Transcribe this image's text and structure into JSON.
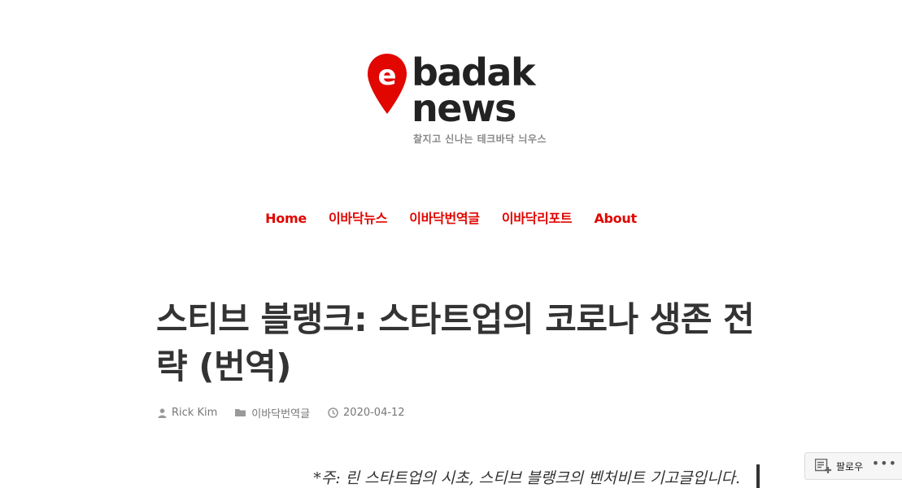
{
  "site": {
    "logo_line1": "badak",
    "logo_line2": "news",
    "logo_pin_letter": "e",
    "tagline": "찰지고 신나는 테크바닥 늬우스",
    "brand_color": "#e10600"
  },
  "nav": {
    "items": [
      "Home",
      "이바닥뉴스",
      "이바닥번역글",
      "이바닥리포트",
      "About"
    ]
  },
  "post": {
    "title": "스티브 블랭크: 스타트업의 코로나 생존 전략 (번역)",
    "author": "Rick Kim",
    "category": "이바닥번역글",
    "date": "2020-04-12",
    "intro": "*주: 린 스타트업의 시초, 스티브 블랭크의 벤처비트 기고글입니다."
  },
  "follow_widget": {
    "label": "팔로우",
    "more": "•••",
    "icon": "reader-follow-icon"
  }
}
